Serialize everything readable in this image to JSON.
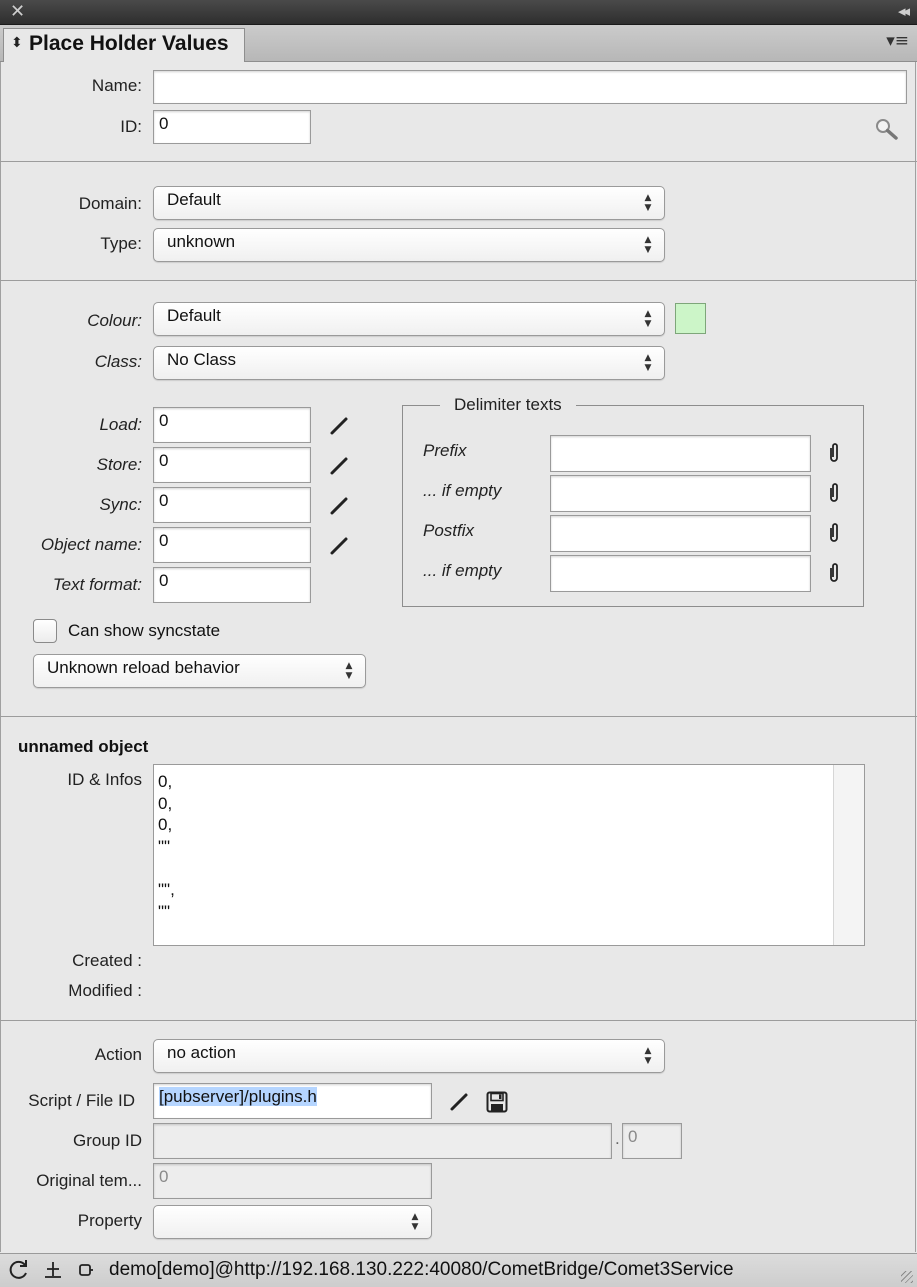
{
  "window": {
    "close_glyph": "✕",
    "collapse_glyph": "◂◂",
    "tab_title": "Place Holder Values",
    "menu_glyph": "▾≡"
  },
  "identity": {
    "name_label": "Name:",
    "name_value": "",
    "id_label": "ID:",
    "id_value": "0"
  },
  "domain_section": {
    "domain_label": "Domain:",
    "domain_value": "Default",
    "type_label": "Type:",
    "type_value": "unknown"
  },
  "appearance": {
    "colour_label": "Colour:",
    "colour_value": "Default",
    "colour_swatch": "#ccf5c8",
    "class_label": "Class:",
    "class_value": "No Class"
  },
  "scripts": {
    "load_label": "Load:",
    "load_value": "0",
    "store_label": "Store:",
    "store_value": "0",
    "sync_label": "Sync:",
    "sync_value": "0",
    "objname_label": "Object name:",
    "objname_value": "0",
    "textformat_label": "Text format:",
    "textformat_value": "0"
  },
  "delimiters": {
    "title": "Delimiter texts",
    "prefix_label": "Prefix",
    "prefix_value": "",
    "prefix_empty_label": "... if empty",
    "prefix_empty_value": "",
    "postfix_label": "Postfix",
    "postfix_value": "",
    "postfix_empty_label": "... if empty",
    "postfix_empty_value": ""
  },
  "sync_options": {
    "can_show_syncstate_label": "Can show syncstate",
    "can_show_syncstate_checked": false,
    "reload_behavior_value": "Unknown reload behavior"
  },
  "object_info": {
    "heading": "unnamed object",
    "id_infos_label": "ID & Infos",
    "id_infos_text": "0,\n0,\n0,\n\"\"\n\n\"\",\n\"\"",
    "created_label": "Created :",
    "created_value": "",
    "modified_label": "Modified :",
    "modified_value": ""
  },
  "action_section": {
    "action_label": "Action",
    "action_value": "no action",
    "script_label": "Script / File ID",
    "script_value": "[pubserver]/plugins.h",
    "group_label": "Group ID",
    "group_value": "",
    "group_suffix_dot": ".",
    "group_suffix_value": "0",
    "original_label": "Original tem...",
    "original_value": "0",
    "property_label": "Property",
    "property_value": ""
  },
  "status": {
    "connection": "demo[demo]@http://192.168.130.222:40080/CometBridge/Comet3Service"
  }
}
